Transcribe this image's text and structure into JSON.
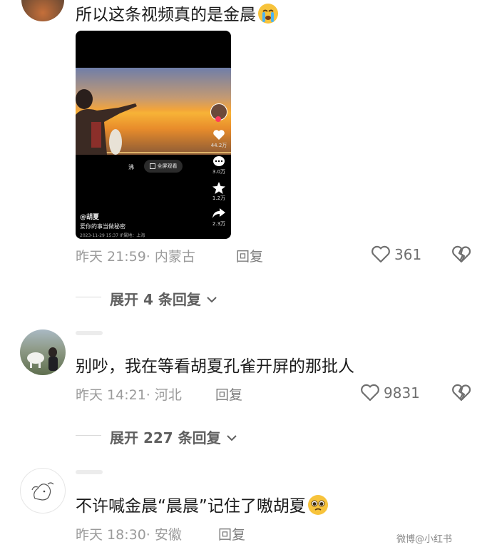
{
  "comments": [
    {
      "text": "所以这条视频真的是金晨",
      "emoji_icon": "loudly-crying-face-icon",
      "time": "昨天 21:59",
      "location": "内蒙古",
      "reply_label": "回复",
      "likes": "361",
      "expand_label": "展开 4 条回复",
      "video": {
        "author": "@胡夏",
        "caption": "爱你的事当做秘密",
        "info": "2023-11-29 15:37 IP属地：上海",
        "like_count": "44.2万",
        "comment_count": "3.0万",
        "fav_count": "1.2万",
        "share_count": "2.3万",
        "center_left_label": "沸",
        "fullscreen_label": "全屏观看"
      }
    },
    {
      "text": "别吵，我在等看胡夏孔雀开屏的那批人",
      "time": "昨天 14:21",
      "location": "河北",
      "reply_label": "回复",
      "likes": "9831",
      "expand_label": "展开 227 条回复"
    },
    {
      "text": "不许喊金晨“晨晨”记住了嗷胡夏",
      "emoji_icon": "pleading-face-icon",
      "time": "昨天 18:30",
      "location": "安徽",
      "reply_label": "回复"
    }
  ],
  "watermark": "微博@小红书"
}
